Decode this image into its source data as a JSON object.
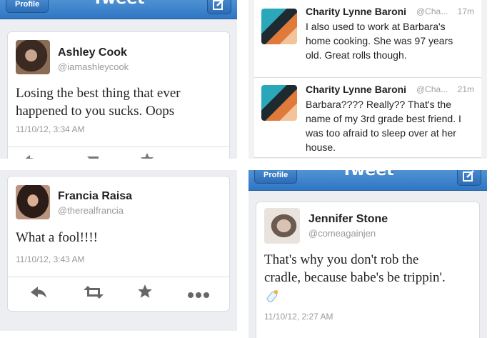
{
  "panel1": {
    "nav": {
      "left_button": "Profile",
      "title": "Tweet"
    },
    "tweet": {
      "name": "Ashley Cook",
      "handle": "@iamashleycook",
      "text_line1": "Losing the best thing that ever",
      "text_line2": "happened to you sucks. Oops",
      "timestamp": "11/10/12, 3:34 AM"
    }
  },
  "panel2": {
    "replies": [
      {
        "name": "Charity Lynne Baroni",
        "handle": "@Cha...",
        "time": "17m",
        "line1": "I also used to work at Barbara's",
        "line2": "home cooking. She was 97 years",
        "line3": "old. Great rolls though."
      },
      {
        "name": "Charity Lynne Baroni",
        "handle": "@Cha...",
        "time": "21m",
        "line1": "Barbara???? Really?? That's the",
        "line2": "name of my 3rd grade best friend. I",
        "line3": "was too afraid to sleep over at her",
        "line4": "house."
      }
    ]
  },
  "panel3": {
    "tweet": {
      "name": "Francia Raisa",
      "handle": "@therealfrancia",
      "text": "What a fool!!!!",
      "timestamp": "11/10/12, 3:43 AM"
    },
    "actions": [
      "reply-icon",
      "retweet-icon",
      "favorite-icon",
      "more-icon"
    ]
  },
  "panel4": {
    "nav": {
      "left_button": "Profile",
      "title": "Tweet"
    },
    "tweet": {
      "name": "Jennifer Stone",
      "handle": "@comeagainjen",
      "text_line1": "That's why you don't rob the",
      "text_line2": "cradle, because babe's be trippin'.",
      "emoji": "baby-bottle-icon",
      "timestamp": "11/10/12, 2:27 AM"
    }
  },
  "colors": {
    "nav_blue": "#2f77c4",
    "icon_gray": "#666666"
  }
}
